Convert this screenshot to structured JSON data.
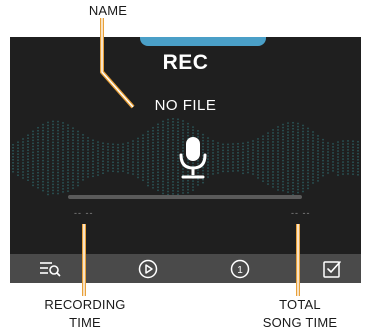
{
  "callouts": {
    "name": "NAME",
    "recording_time_line1": "RECORDING",
    "recording_time_line2": "TIME",
    "total_song_time_line1": "TOTAL",
    "total_song_time_line2": "SONG TIME"
  },
  "screen": {
    "title": "REC",
    "file_name": "NO FILE",
    "recording_time": "-- --",
    "total_time": "-- --",
    "progress": 0
  },
  "toolbar": {
    "items": [
      {
        "icon": "list-search-icon"
      },
      {
        "icon": "play-circle-icon"
      },
      {
        "icon": "repeat-one-icon",
        "label": "1"
      },
      {
        "icon": "checkbox-icon"
      }
    ]
  },
  "colors": {
    "screen_bg": "#1f1f1f",
    "accent": "#4a9fc7",
    "toolbar_bg": "#4a4a4a",
    "wave": "#2f6f73",
    "leader_line": "#e8a13a"
  }
}
